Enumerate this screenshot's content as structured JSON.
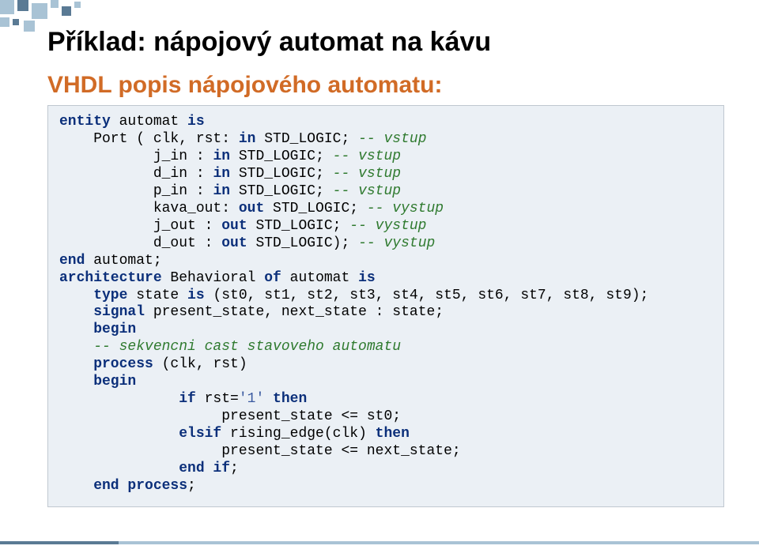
{
  "title": "Příklad: nápojový automat na kávu",
  "subtitle": "VHDL popis nápojového automatu:",
  "code": {
    "l01a": "entity",
    "l01b": " automat ",
    "l01c": "is",
    "l02a": "    Port ( clk, rst: ",
    "l02b": "in",
    "l02c": " STD_LOGIC; ",
    "l02cm": "-- vstup",
    "l03a": "           j_in : ",
    "l03b": "in",
    "l03c": " STD_LOGIC; ",
    "l03cm": "-- vstup",
    "l04a": "           d_in : ",
    "l04b": "in",
    "l04c": " STD_LOGIC; ",
    "l04cm": "-- vstup",
    "l05a": "           p_in : ",
    "l05b": "in",
    "l05c": " STD_LOGIC; ",
    "l05cm": "-- vstup",
    "l06a": "           kava_out: ",
    "l06b": "out",
    "l06c": " STD_LOGIC; ",
    "l06cm": "-- vystup",
    "l07a": "           j_out : ",
    "l07b": "out",
    "l07c": " STD_LOGIC; ",
    "l07cm": "-- vystup",
    "l08a": "           d_out : ",
    "l08b": "out",
    "l08c": " STD_LOGIC); ",
    "l08cm": "-- vystup",
    "l09a": "end",
    "l09b": " automat;",
    "l10a": "architecture",
    "l10b": " Behavioral ",
    "l10c": "of",
    "l10d": " automat ",
    "l10e": "is",
    "l11a": "    type",
    "l11b": " state ",
    "l11c": "is",
    "l11d": " (st0, st1, st2, st3, st4, st5, st6, st7, st8, st9);",
    "l12a": "    signal",
    "l12b": " present_state, next_state : state;",
    "l13a": "    begin",
    "l14cm": "    -- sekvencni cast stavoveho automatu",
    "l15a": "    process",
    "l15b": " (clk, rst)",
    "l16a": "    begin",
    "l17a": "              if",
    "l17b": " rst=",
    "l17s": "'1'",
    "l17c": " then",
    "l18a": "                   present_state <= st0;",
    "l19a": "              elsif",
    "l19b": " rising_edge(clk) ",
    "l19c": "then",
    "l20a": "                   present_state <= next_state;",
    "l21a": "              end if",
    "l21b": ";",
    "l22a": "    end process",
    "l22b": ";"
  }
}
